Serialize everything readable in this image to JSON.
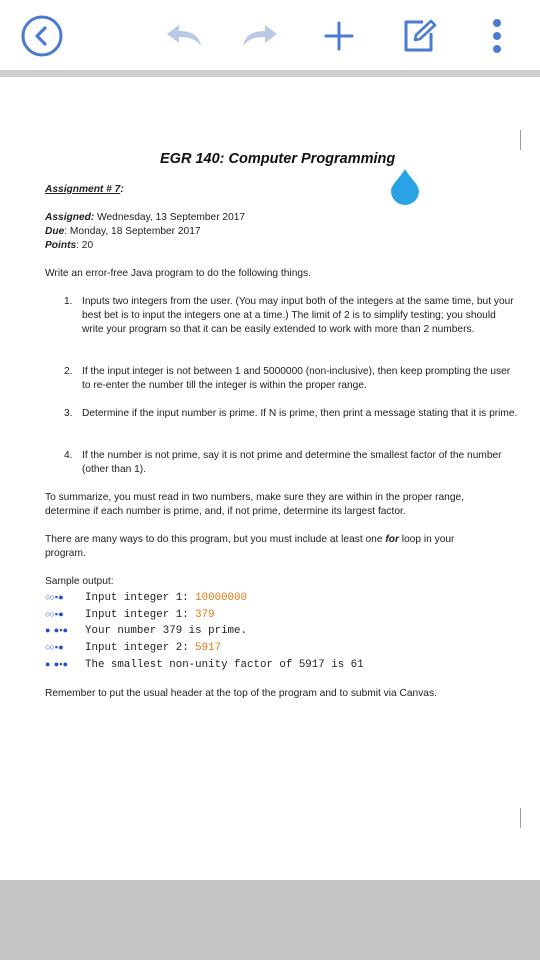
{
  "toolbar": {
    "back": "back-circle-icon",
    "undo": "undo-icon",
    "redo": "redo-icon",
    "add": "plus-icon",
    "edit": "edit-icon",
    "more": "more-vert-icon",
    "accent": "#4a7bd0"
  },
  "doc": {
    "title": "EGR 140: Computer Programming",
    "assignment": "Assignment # 7",
    "assignment_suffix": ":",
    "assigned_label": "Assigned:",
    "assigned_value": " Wednesday, 13 September 2017",
    "due_label": "Due",
    "due_value": ": Monday, 18 September 2017",
    "points_label": "Points",
    "points_value": ": 20",
    "intro": "Write an error-free Java program to do the following things.",
    "items": [
      {
        "num": "1.",
        "text": "Inputs two integers from the user.  (You may input both of the integers at the same time, but your best bet is to input the integers one at a time.) The limit of 2 is to simplify testing; you should write your program so that it can be easily extended to work with more than 2 numbers."
      },
      {
        "num": "2.",
        "text": "If the input integer is not between 1 and 5000000 (non-inclusive), then keep prompting the user to re-enter the number till the integer is within the proper range."
      },
      {
        "num": "3.",
        "text": "Determine if the input number is prime.  If N is prime, then print a message stating that it is prime."
      },
      {
        "num": "4.",
        "text": "If the number is not prime, say it is not prime and determine the smallest factor of the number (other than 1)."
      }
    ],
    "summary_1": "To summarize, you must read in two numbers, make sure they are within in the proper range,",
    "summary_2": "determine if each number is prime, and, if not prime, determine its largest factor.",
    "many_1a": "There are many ways to do this program, but you must include at least one ",
    "many_1b": "for",
    "many_1c": " loop in your",
    "many_2": "program.",
    "sample_label": "Sample output:",
    "sample_lines": [
      {
        "glyph": "○○▪●",
        "text": "Input integer 1: ",
        "value": "10000000"
      },
      {
        "glyph": "○○▪●",
        "text": "Input integer 1: ",
        "value": "379"
      },
      {
        "glyph": "● ●▪●",
        "text": "Your number 379 is prime.",
        "value": ""
      },
      {
        "glyph": "○○▪●",
        "text": "Input integer 2: ",
        "value": "5917"
      },
      {
        "glyph": "● ●▪●",
        "text": "The smallest non-unity factor of 5917 is 61",
        "value": ""
      }
    ],
    "remember": "Remember to put the usual header at the top of the program and to submit via Canvas."
  }
}
